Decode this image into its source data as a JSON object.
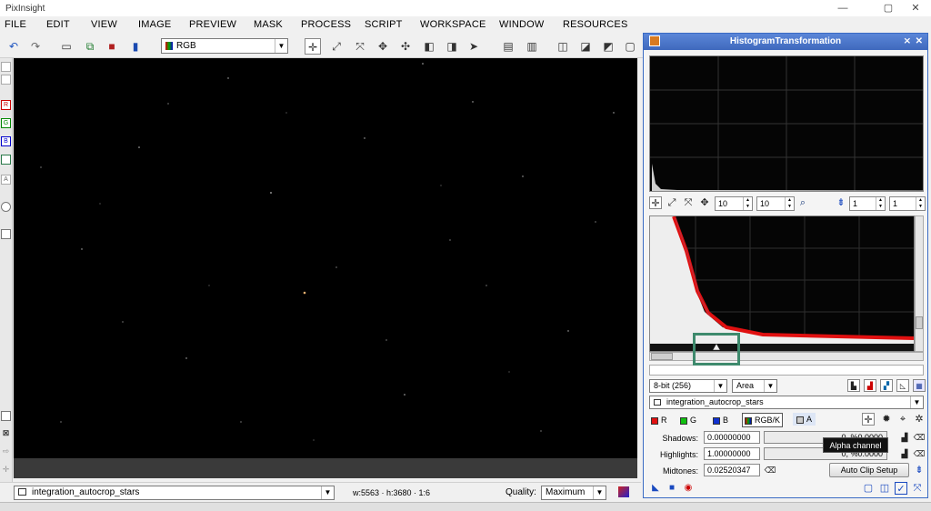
{
  "app": {
    "title": "PixInsight"
  },
  "window_controls": {
    "minimize": "—",
    "maximize": "▢",
    "close": "✕"
  },
  "menu": [
    "FILE",
    "EDIT",
    "VIEW",
    "IMAGE",
    "PREVIEW",
    "MASK",
    "PROCESS",
    "SCRIPT",
    "WORKSPACE",
    "WINDOW",
    "RESOURCES"
  ],
  "toolbar": {
    "color_space": "RGB"
  },
  "left_strip": [
    "R",
    "G",
    "B",
    "",
    "A"
  ],
  "image_window": {
    "view_name": "integration_autocrop_stars",
    "dimensions": "w:5563 · h:3680 · 1:6",
    "quality_label": "Quality:",
    "quality_value": "Maximum"
  },
  "histogram_panel": {
    "title": "HistogramTransformation",
    "zoom_h": "10",
    "zoom_v": "10",
    "zoom_h2": "1",
    "zoom_v2": "1",
    "resolution": "8-bit (256)",
    "graph_style": "Area",
    "view_selector": "integration_autocrop_stars",
    "channels": [
      {
        "label": "R",
        "color": "#e01010"
      },
      {
        "label": "G",
        "color": "#10c010"
      },
      {
        "label": "B",
        "color": "#1030d0"
      },
      {
        "label": "RGB/K",
        "color": "#8a6a30"
      },
      {
        "label": "A",
        "color": "#cccccc"
      }
    ],
    "shadows_label": "Shadows:",
    "shadows_value": "0.00000000",
    "shadows_clip": "0, %0.0000",
    "highlights_label": "Highlights:",
    "highlights_value": "1.00000000",
    "highlights_clip": "0, %0.0000",
    "midtones_label": "Midtones:",
    "midtones_value": "0.02520347",
    "auto_clip_button": "Auto Clip Setup",
    "tooltip": "Alpha channel"
  }
}
